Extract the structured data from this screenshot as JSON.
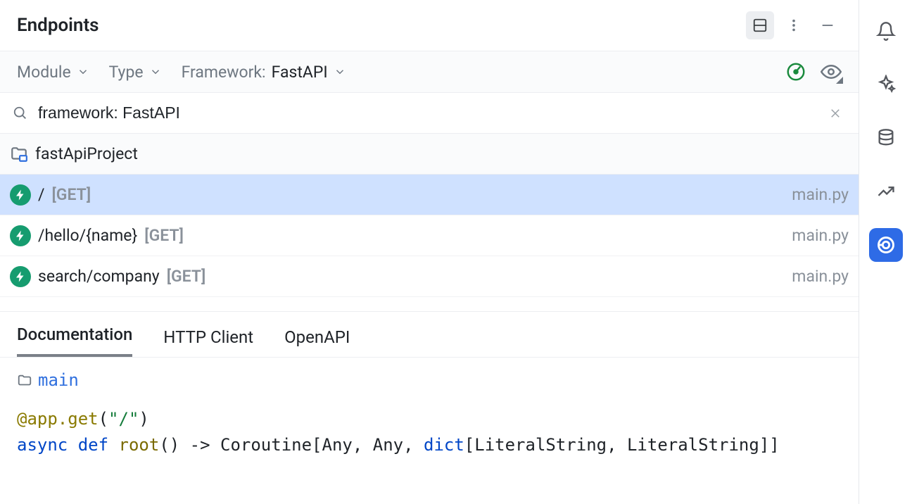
{
  "header": {
    "title": "Endpoints"
  },
  "filters": {
    "module_label": "Module",
    "type_label": "Type",
    "framework_label": "Framework:",
    "framework_value": "FastAPI"
  },
  "search": {
    "value": "framework: FastAPI"
  },
  "project": {
    "name": "fastApiProject"
  },
  "endpoints": [
    {
      "path": "/",
      "method": "[GET]",
      "file": "main.py",
      "selected": true
    },
    {
      "path": "/hello/{name}",
      "method": "[GET]",
      "file": "main.py",
      "selected": false
    },
    {
      "path": "search/company",
      "method": "[GET]",
      "file": "main.py",
      "selected": false
    }
  ],
  "tabs": [
    {
      "label": "Documentation",
      "active": true
    },
    {
      "label": "HTTP Client",
      "active": false
    },
    {
      "label": "OpenAPI",
      "active": false
    }
  ],
  "doc": {
    "file_label": "main",
    "decorator_prefix": "@app.get",
    "decorator_arg": "\"/\"",
    "sig_async": "async",
    "sig_def": "def",
    "sig_name": "root",
    "sig_mid": "() -> Coroutine[Any, Any, ",
    "sig_dict": "dict",
    "sig_tail": "[LiteralString, LiteralString]]"
  },
  "rail": {
    "items": [
      "notifications",
      "ai",
      "database",
      "statistics",
      "endpoints"
    ],
    "active": "endpoints"
  }
}
